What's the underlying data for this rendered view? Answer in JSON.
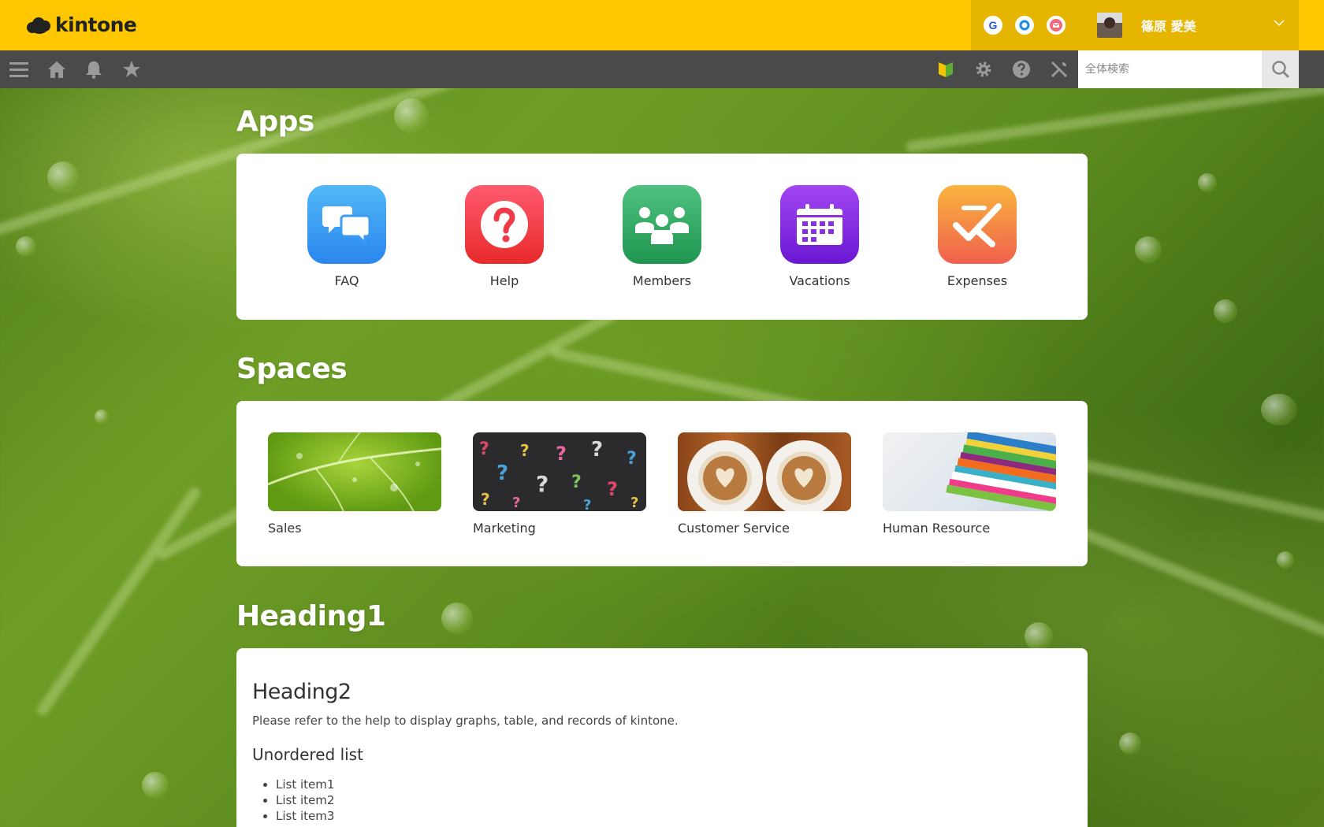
{
  "header": {
    "logo_text": "kintone",
    "services": [
      {
        "name": "google-service-icon",
        "glyph": "G",
        "color": "#2a57c7"
      },
      {
        "name": "outlook-service-icon",
        "glyph": "",
        "color": "#1a8de0"
      },
      {
        "name": "mail-service-icon",
        "glyph": "",
        "color": "#e94b5b"
      }
    ],
    "user_name": "篠原 愛美"
  },
  "toolbar": {
    "search_placeholder": "全体検索"
  },
  "apps": {
    "title": "Apps",
    "items": [
      {
        "label": "FAQ",
        "icon": "chat-bubbles-icon",
        "colors": [
          "#52b9f7",
          "#2a86ee"
        ]
      },
      {
        "label": "Help",
        "icon": "question-icon",
        "colors": [
          "#ff5a6e",
          "#e82a2a"
        ]
      },
      {
        "label": "Members",
        "icon": "people-icon",
        "colors": [
          "#4fc27f",
          "#1f9650"
        ]
      },
      {
        "label": "Vacations",
        "icon": "calendar-icon",
        "colors": [
          "#a246f2",
          "#6a17d2"
        ]
      },
      {
        "label": "Expenses",
        "icon": "expense-check-icon",
        "colors": [
          "#f9b53d",
          "#f0604d"
        ]
      }
    ]
  },
  "spaces": {
    "title": "Spaces",
    "items": [
      {
        "label": "Sales",
        "thumbnail": "leaf-thumbnail"
      },
      {
        "label": "Marketing",
        "thumbnail": "question-marks-thumbnail"
      },
      {
        "label": "Customer Service",
        "thumbnail": "coffee-thumbnail"
      },
      {
        "label": "Human Resource",
        "thumbnail": "books-thumbnail"
      }
    ]
  },
  "content": {
    "heading1": "Heading1",
    "heading2": "Heading2",
    "paragraph": "Please refer to the help to display graphs, table, and records of kintone.",
    "list_heading": "Unordered list",
    "list_items": [
      "List item1",
      "List item2",
      "List item3"
    ]
  }
}
